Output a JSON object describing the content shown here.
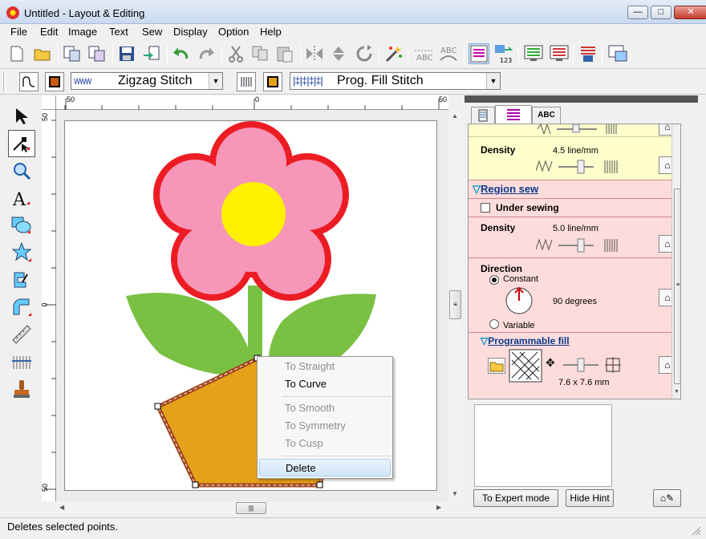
{
  "window": {
    "title": "Untitled - Layout & Editing",
    "min": "—",
    "max": "□",
    "close": "✕"
  },
  "menu": [
    "File",
    "Edit",
    "Image",
    "Text",
    "Sew",
    "Display",
    "Option",
    "Help"
  ],
  "toolbar2": {
    "line_stitch": "Zigzag Stitch",
    "region_stitch": "Prog. Fill Stitch"
  },
  "ruler": {
    "unit": "mm",
    "h_ticks": [
      "50",
      "0",
      "50"
    ],
    "v_ticks": [
      "50",
      "0",
      "50"
    ]
  },
  "context_menu": {
    "items": [
      {
        "label": "To Straight",
        "enabled": false
      },
      {
        "label": "To Curve",
        "enabled": true
      },
      {
        "label": "To Smooth",
        "enabled": false
      },
      {
        "label": "To Symmetry",
        "enabled": false
      },
      {
        "label": "To Cusp",
        "enabled": false
      },
      {
        "label": "Delete",
        "enabled": true,
        "highlighted": true
      }
    ]
  },
  "panel": {
    "tabs": [
      "",
      "",
      "ABC"
    ],
    "density1": {
      "label": "Density",
      "value": "4.5 line/mm"
    },
    "region_sew": {
      "title": "Region sew",
      "under_sewing": "Under sewing",
      "under_sewing_checked": false
    },
    "density2": {
      "label": "Density",
      "value": "5.0 line/mm"
    },
    "direction": {
      "label": "Direction",
      "constant": "Constant",
      "degrees": "90 degrees",
      "variable": "Variable",
      "selected": "Constant"
    },
    "prog_fill": {
      "title": "Programmable fill",
      "size": "7.6 x 7.6 mm"
    },
    "buttons": {
      "expert": "To Expert mode",
      "hint": "Hide Hint"
    }
  },
  "colors": {
    "petal": "#f696b8",
    "petal_outline": "#ec1c24",
    "center": "#fff200",
    "leaf": "#7ac143",
    "pot": "#e5a11a",
    "pot_outline": "#a0461c",
    "yellow_bg": "#ffffcc",
    "pink_bg": "#ffdcdc"
  },
  "status": "Deletes selected points."
}
